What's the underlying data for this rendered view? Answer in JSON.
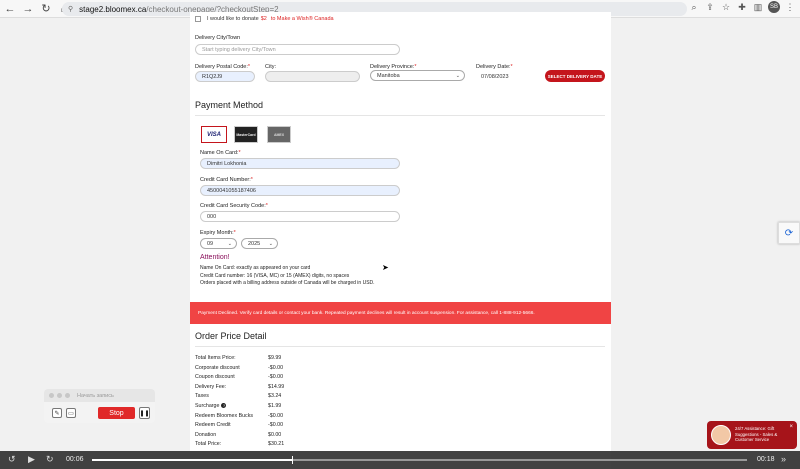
{
  "browser": {
    "url_domain": "stage2.bloomex.ca",
    "url_path": "/checkout-onepage/?checkoutStep=2",
    "avatar": "SB"
  },
  "form": {
    "donate_text_1": "I would like to donate",
    "donate_amount": "$2",
    "donate_text_2": "to Make a Wish® Canada",
    "city_town_label": "Delivery City/Town",
    "city_town_placeholder": "Start typing delivery City/Town",
    "postal_label": "Delivery Postal Code:",
    "postal_value": "R1Q2J9",
    "city_label": "City:",
    "city_value": "",
    "province_label": "Delivery Province:",
    "province_value": "Manitoba",
    "date_label": "Delivery Date:",
    "date_value": "07/08/2023",
    "select_date_button": "SELECT DELIVERY DATE"
  },
  "payment": {
    "title": "Payment Method",
    "cards": [
      "VISA",
      "MasterCard",
      "AMEX"
    ],
    "name_label": "Name On Card:",
    "name_value": "Dimitri Lokhonia",
    "number_label": "Credit Card Number:",
    "number_value": "4500041055187406",
    "cvv_label": "Credit Card Security Code:",
    "cvv_value": "000",
    "expiry_label": "Expiry Month:",
    "expiry_month": "09",
    "expiry_year": "2025",
    "attention_title": "Attention!",
    "note_1": "Name On Card: exactly as appeared on your card",
    "note_2": "Credit Card number: 16 (VISA, MC) or 15 (AMEX) digits, no spaces",
    "note_3": "Orders placed with a billing address outside of Canada will be charged in USD."
  },
  "alert": {
    "message": "Payment Declined. Verify card details or contact your bank. Repeated payment declines will result in account suspension. For assistance, call 1-888-912-5666."
  },
  "order": {
    "title": "Order Price Detail",
    "rows": [
      {
        "label": "Total Items Price:",
        "value": "$9.99"
      },
      {
        "label": "Corporate discount",
        "value": "-$0.00"
      },
      {
        "label": "Coupon discount",
        "value": "-$0.00"
      },
      {
        "label": "Delivery Fee:",
        "value": "$14.99"
      },
      {
        "label": "Taxes",
        "value": "$3.24"
      },
      {
        "label": "Surcharge",
        "value": "$1.99"
      },
      {
        "label": "Redeem Bloomex Bucks",
        "value": "-$0.00"
      },
      {
        "label": "Redeem Credit",
        "value": "-$0.00"
      },
      {
        "label": "Donation",
        "value": "$0.00"
      },
      {
        "label": "Total Price:",
        "value": "$30.21"
      }
    ]
  },
  "recorder": {
    "title": "Начать запись",
    "stop_label": "Stop"
  },
  "chat": {
    "text": "24/7 Assistance: Gift Suggestions - Sales & Customer Service"
  },
  "video": {
    "current_time": "00:06",
    "total_time": "00:18",
    "progress": 0.305
  }
}
